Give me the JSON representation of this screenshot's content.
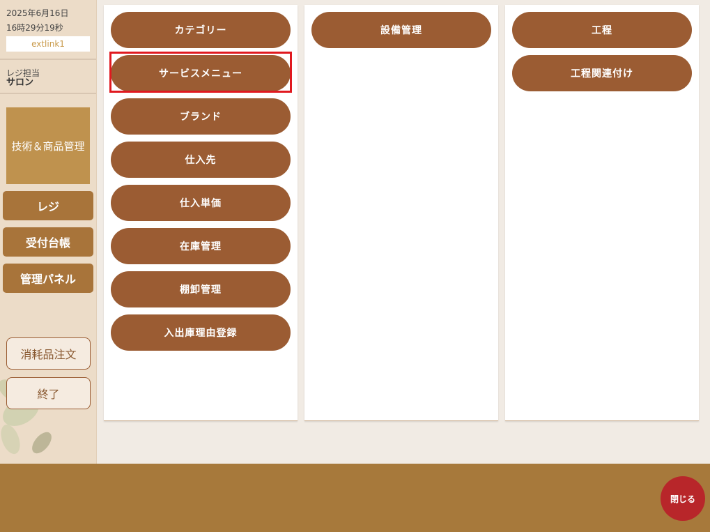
{
  "sidebar": {
    "date": "2025年6月16日",
    "time": "16時29分19秒",
    "store_id": "extlink1",
    "cashier_label": "レジ担当",
    "cashier_name": "サロン",
    "tech_button": "技術＆商品管理",
    "nav": [
      "レジ",
      "受付台帳",
      "管理パネル"
    ],
    "consumables_button": "消耗品注文",
    "exit_button": "終了"
  },
  "panels": {
    "left": [
      "カテゴリー",
      "サービスメニュー",
      "ブランド",
      "仕入先",
      "仕入単価",
      "在庫管理",
      "棚卸管理",
      "入出庫理由登録"
    ],
    "middle": [
      "設備管理"
    ],
    "right": [
      "工程",
      "工程関連付け"
    ]
  },
  "footer": {
    "close_button": "閉じる"
  },
  "colors": {
    "pill": "#9b5c33",
    "nav": "#a8743a",
    "footer": "#a7793b",
    "highlight": "#e0191f",
    "close": "#b8262a"
  }
}
